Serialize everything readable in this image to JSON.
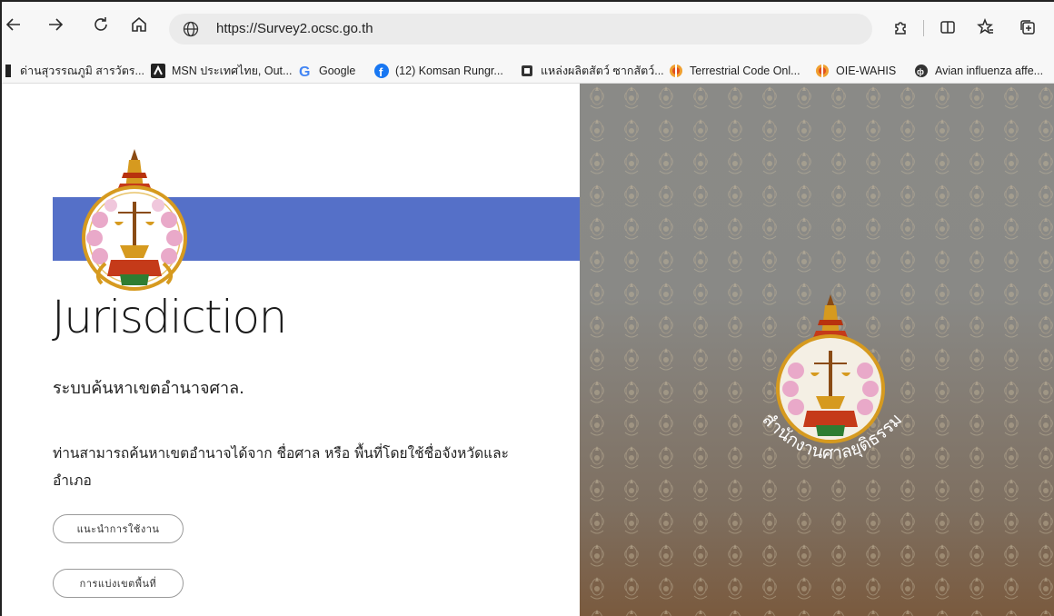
{
  "browser": {
    "url": "https://Survey2.ocsc.go.th",
    "nav_icons": [
      "back-arrow-icon",
      "forward-arrow-icon",
      "refresh-icon",
      "home-icon"
    ],
    "right_icons": [
      "extensions-icon",
      "split-screen-icon",
      "favorites-icon",
      "collections-icon"
    ]
  },
  "bookmarks": [
    {
      "label": "ด่านสุวรรณภูมิ สารวัตร...",
      "icon": "folder-icon"
    },
    {
      "label": "MSN ประเทศไทย, Out...",
      "icon": "msn-icon"
    },
    {
      "label": "Google",
      "icon": "google-icon"
    },
    {
      "label": "(12) Komsan Rungr...",
      "icon": "facebook-icon"
    },
    {
      "label": "แหล่งผลิตสัตว์ ซากสัตว์...",
      "icon": "site-icon"
    },
    {
      "label": "Terrestrial Code Onl...",
      "icon": "woah-icon"
    },
    {
      "label": "OIE-WAHIS",
      "icon": "woah-icon"
    },
    {
      "label": "Avian influenza affe...",
      "icon": "site-icon"
    }
  ],
  "hero": {
    "title": "Jurisdiction",
    "subtitle": "ระบบค้นหาเขตอำนาจศาล.",
    "description": "ท่านสามารถค้นหาเขตอำนาจได้จาก ชื่อศาล หรือ พื้นที่โดยใช้ชื่อจังหวัดและอำเภอ",
    "buttons": [
      "แนะนำการใช้งาน",
      "การแบ่งเขตพื้นที่"
    ]
  },
  "seal": {
    "text": "สำนักงานศาลยุติธรรม"
  },
  "colors": {
    "accent_blue": "#5570c8",
    "emblem_gold": "#d69a1f",
    "emblem_red": "#c0392b"
  }
}
